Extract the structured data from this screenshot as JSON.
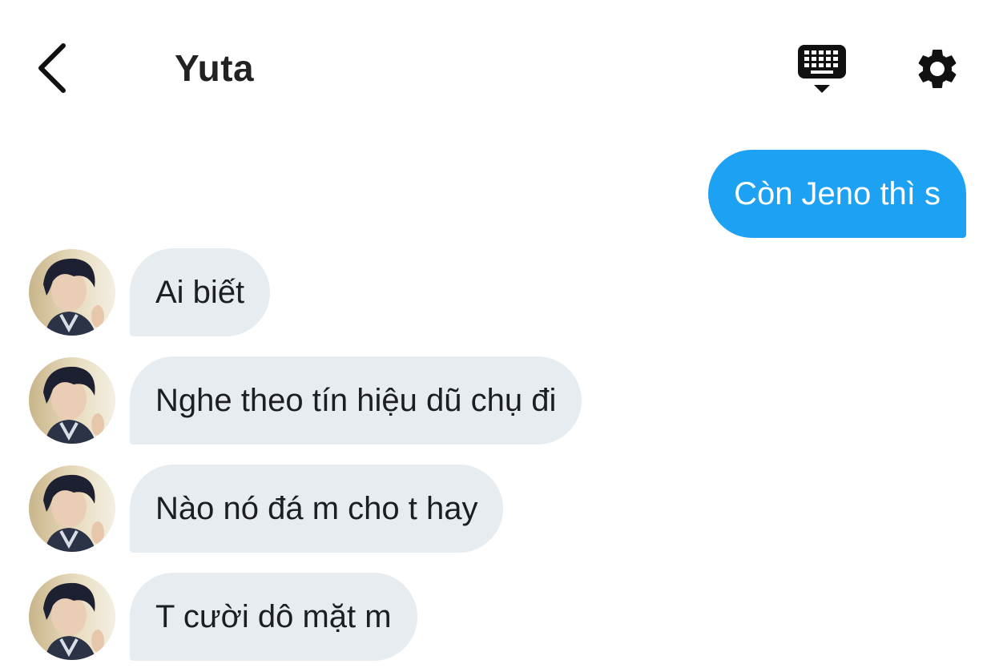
{
  "header": {
    "back_icon": "chevron-left-icon",
    "title": "Yuta",
    "keyboard_icon": "keyboard-hide-icon",
    "settings_icon": "gear-icon"
  },
  "colors": {
    "outgoing_bubble": "#1da1f2",
    "incoming_bubble": "#e6ecf0",
    "text": "#1c1e21"
  },
  "messages": [
    {
      "direction": "outgoing",
      "text": "Còn Jeno thì s"
    },
    {
      "direction": "incoming",
      "text": "Ai biết"
    },
    {
      "direction": "incoming",
      "text": "Nghe theo tín hiệu dũ chụ đi"
    },
    {
      "direction": "incoming",
      "text": "Nào nó đá m cho t hay"
    },
    {
      "direction": "incoming",
      "text": "T cười dô mặt m"
    }
  ]
}
